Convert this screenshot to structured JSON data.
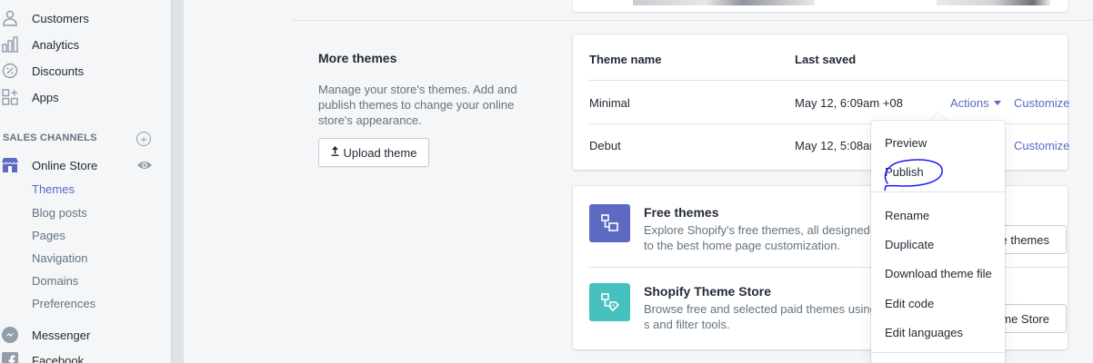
{
  "sidebar": {
    "items": [
      {
        "label": "Customers",
        "icon": "person-icon"
      },
      {
        "label": "Analytics",
        "icon": "bar-chart-icon"
      },
      {
        "label": "Discounts",
        "icon": "discount-badge-icon"
      },
      {
        "label": "Apps",
        "icon": "apps-grid-icon"
      }
    ],
    "sales_channels_heading": "SALES CHANNELS",
    "online_store": {
      "label": "Online Store",
      "icon": "storefront-icon"
    },
    "sub_items": [
      "Themes",
      "Blog posts",
      "Pages",
      "Navigation",
      "Domains",
      "Preferences"
    ],
    "active_sub": "Themes",
    "messenger": {
      "label": "Messenger",
      "icon": "messenger-icon"
    },
    "facebook": {
      "label": "Facebook",
      "icon": "facebook-icon"
    }
  },
  "more_themes": {
    "title": "More themes",
    "description": "Manage your store's themes. Add and publish themes to change your online store's appearance.",
    "upload_button": "Upload theme"
  },
  "themes_table": {
    "headers": {
      "name": "Theme name",
      "saved": "Last saved"
    },
    "rows": [
      {
        "name": "Minimal",
        "saved": "May 12, 6:09am +08",
        "actions": "Actions",
        "customize": "Customize"
      },
      {
        "name": "Debut",
        "saved": "May 12, 5:08am",
        "customize": "Customize"
      }
    ]
  },
  "actions_menu": {
    "items_group1": [
      "Preview",
      "Publish"
    ],
    "items_group2": [
      "Rename",
      "Duplicate",
      "Download theme file",
      "Edit code",
      "Edit languages"
    ]
  },
  "free_themes": {
    "title": "Free themes",
    "description": "Explore Shopify's free themes, all designed to the best home page customization.",
    "button": "e themes",
    "icon_color": "#5c6ac4"
  },
  "theme_store": {
    "title": "Shopify Theme Store",
    "description": "Browse free and selected paid themes using s and filter tools.",
    "button": "me Store",
    "icon_color": "#47c1bf"
  },
  "colors": {
    "accent": "#5c6ac4",
    "annotation": "#1a1aff"
  }
}
